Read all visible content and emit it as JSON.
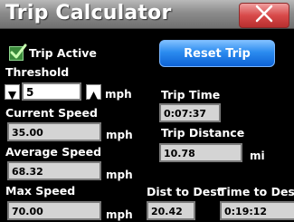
{
  "window": {
    "title": "Trip Calculator"
  },
  "trip_active": {
    "label": "Trip Active",
    "checked": true
  },
  "reset_button": {
    "label": "Reset Trip"
  },
  "threshold": {
    "label": "Threshold",
    "value": "5",
    "unit": "mph"
  },
  "trip_time": {
    "label": "Trip Time",
    "value": "0:07:37"
  },
  "current_speed": {
    "label": "Current Speed",
    "value": "35.00",
    "unit": "mph"
  },
  "trip_distance": {
    "label": "Trip Distance",
    "value": "10.78",
    "unit": "mi"
  },
  "average_speed": {
    "label": "Average Speed",
    "value": "68.32",
    "unit": "mph"
  },
  "max_speed": {
    "label": "Max Speed",
    "value": "70.00",
    "unit": "mph"
  },
  "dist_to_dest": {
    "label": "Dist to Dest",
    "value": "20.42"
  },
  "time_to_dest": {
    "label": "Time to Dest",
    "value": "0:19:12"
  },
  "colors": {
    "title_bar": "#8c8c8c",
    "close": "#d84a4a",
    "reset": "#2b8bef",
    "field": "#d4d4d4",
    "check": "#3b8a3b"
  },
  "icons": {
    "close": "close-icon",
    "check": "checkmark-icon",
    "decrement": "triangle-left-icon",
    "increment": "triangle-right-icon"
  }
}
